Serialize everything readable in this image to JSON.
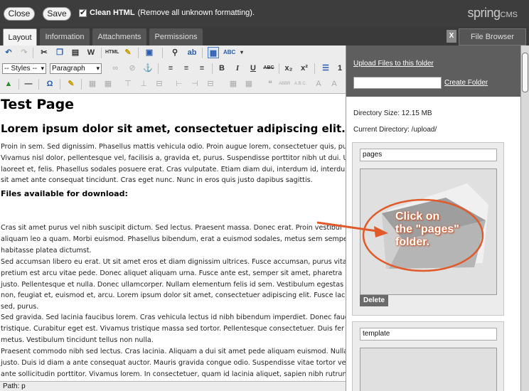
{
  "topbar": {
    "close_label": "Close",
    "save_label": "Save",
    "clean_html_label": "Clean HTML",
    "clean_html_desc": "(Remove all unknown formatting).",
    "logo_main": "spring",
    "logo_sub": "CMS"
  },
  "tabs": [
    "Layout",
    "Information",
    "Attachments",
    "Permissions"
  ],
  "file_browser_tab": {
    "close": "X",
    "label": "File Browser"
  },
  "toolbar": {
    "styles_select": "-- Styles --",
    "format_select": "Paragraph"
  },
  "editor": {
    "title": "Test Page",
    "heading": "Lorem ipsum dolor sit amet, consectetuer adipiscing elit.",
    "para1": [
      "Proin in sem. Sed dignissim. Phasellus mattis vehicula odio. Proin augue lorem, consectetuer quis, pu",
      "Vivamus nisl dolor, pellentesque vel, facilisis a, gravida et, purus. Suspendisse porttitor nibh ut dui. U",
      "laoreet et, felis. Phasellus sodales posuere erat. Cras vulputate. Etiam diam dui, interdum id, interdu",
      "sit amet ante consequat tincidunt. Cras eget nunc. Nunc in eros quis justo dapibus sagittis."
    ],
    "downloads_heading": "Files available for download:",
    "para2": [
      "Cras sit amet purus vel nibh suscipit dictum. Sed lectus. Praesent massa. Donec erat. Proin vestibul",
      "aliquam leo a quam. Morbi euismod. Phasellus bibendum, erat a euismod sodales, metus sem sempe",
      "habitasse platea dictumst."
    ],
    "para3": [
      "Sed accumsan libero eu erat. Ut sit amet eros et diam dignissim ultrices. Fusce accumsan, purus vita",
      "pretium est arcu vitae pede. Donec aliquet aliquam urna. Fusce ante est, semper sit amet, pharetra",
      "justo. Pellentesque et nulla. Donec ullamcorper. Nullam elementum felis id sem. Vestibulum egestas",
      "non, feugiat et, euismod et, arcu. Lorem ipsum dolor sit amet, consectetuer adipiscing elit. Fusce lac",
      "sed, purus."
    ],
    "para4": [
      "Sed gravida. Sed lacinia faucibus lorem. Cras vehicula lectus id nibh bibendum imperdiet. Donec fauc",
      "tristique. Curabitur eget est. Vivamus tristique massa sed tortor. Pellentesque consectetuer. Duis fer",
      "metus. Vestibulum tincidunt tellus non nulla."
    ],
    "para5": [
      "Praesent commodo nibh sed lectus. Cras lacinia. Aliquam a dui sit amet pede aliquam euismod. Nulla",
      "justo. Duis id diam a ante consequat auctor. Mauris gravida congue odio. Suspendisse vitae tortor ve",
      "ante sollicitudin porttitor. Vivamus lorem. In consectetuer, quam id lacinia aliquet, sapien nibh rutrun"
    ]
  },
  "path_bar": "Path: p",
  "file_browser": {
    "upload_link": "Upload Files to this folder",
    "create_folder_link": "Create Folder",
    "directory_size": "Directory Size: 12.15 MB",
    "current_directory": "Current Directory: /upload/",
    "folders": [
      {
        "name": "pages",
        "delete_label": "Delete"
      },
      {
        "name": "template"
      }
    ]
  },
  "annotation": {
    "text": [
      "Click on",
      "the \"pages\"",
      "folder."
    ],
    "color": "#e05a2a"
  }
}
